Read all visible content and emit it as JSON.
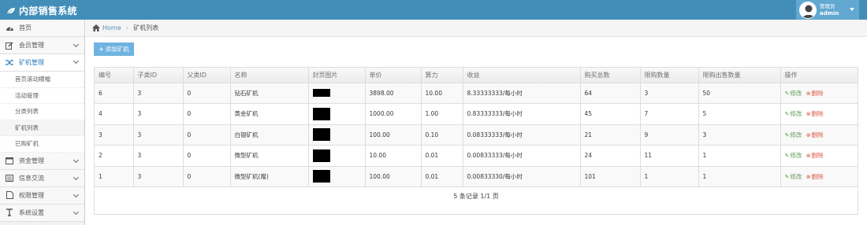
{
  "header": {
    "title": "内部销售系统",
    "user_role": "管理员",
    "user_name": "admin"
  },
  "sidebar": {
    "items": [
      {
        "label": "首页",
        "icon": "dashboard-icon"
      },
      {
        "label": "会员管理",
        "icon": "edit-icon"
      },
      {
        "label": "矿机管理",
        "icon": "shuffle-icon"
      },
      {
        "label": "资金管理",
        "icon": "calendar-icon"
      },
      {
        "label": "信息交流",
        "icon": "list-alt-icon"
      },
      {
        "label": "权限管理",
        "icon": "file-icon"
      },
      {
        "label": "系统设置",
        "icon": "text-icon"
      }
    ],
    "sub_items": [
      "首页滚动横幅",
      "活动管理",
      "分类列表",
      "矿机列表",
      "已购矿机"
    ]
  },
  "breadcrumb": {
    "home": "Home",
    "current": "矿机列表"
  },
  "toolbar": {
    "add_label": "添加矿机"
  },
  "table": {
    "headers": [
      "编号",
      "子类ID",
      "父类ID",
      "名称",
      "封页图片",
      "单价",
      "算力",
      "收益",
      "购买总数",
      "限购数量",
      "限购出售数量",
      "操作"
    ],
    "rows": [
      [
        "6",
        "3",
        "0",
        "钻石矿机",
        "",
        "3898.00",
        "10.00",
        "8.33333333/每小时",
        "64",
        "3",
        "50"
      ],
      [
        "4",
        "3",
        "0",
        "黄金矿机",
        "",
        "1000.00",
        "1.00",
        "0.83333333/每小时",
        "45",
        "7",
        "5"
      ],
      [
        "3",
        "3",
        "0",
        "白银矿机",
        "",
        "100.00",
        "0.10",
        "0.08333333/每小时",
        "21",
        "9",
        "3"
      ],
      [
        "2",
        "3",
        "0",
        "微型矿机",
        "",
        "10.00",
        "0.01",
        "0.00833333/每小时",
        "24",
        "11",
        "1"
      ],
      [
        "1",
        "3",
        "0",
        "微型矿机(赠)",
        "",
        "100.00",
        "0.01",
        "0.00833330/每小时",
        "101",
        "1",
        "1"
      ]
    ],
    "edit_label": "修改",
    "delete_label": "删除",
    "footer": "5 条记录 1/1 页"
  },
  "colors": {
    "topbar": "#438eb9",
    "accent": "#6fb3e0",
    "edit": "#629b58",
    "delete": "#dd5a43"
  }
}
